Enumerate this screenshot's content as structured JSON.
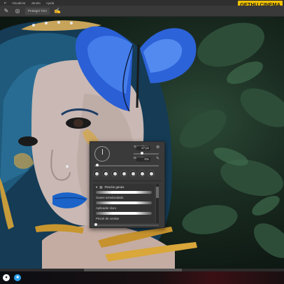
{
  "menubar": {
    "items": [
      "P",
      "Visualizar",
      "Janela",
      "Ajuda"
    ]
  },
  "options": {
    "icon_left": "brush-tool-icon",
    "button": "Proteger Tom",
    "icon_right": "pen-pressure-icon"
  },
  "watermark": "GETHU CINEMA",
  "brush_panel": {
    "size_label": "Tamanho:",
    "size_value": "17 px",
    "hardness_label": "Dureza:",
    "hardness_value": "0%",
    "preset_group": "Pincéis gerais",
    "brushes": [
      "Suave arredondado",
      "Aplicador duro",
      "Pincel de cerdas"
    ],
    "settings_icon": "gear-icon"
  },
  "colors": {
    "panel_bg": "#3a3a3a",
    "watermark_bg": "#f2c200",
    "menubar_bg": "#2f2f2f"
  }
}
